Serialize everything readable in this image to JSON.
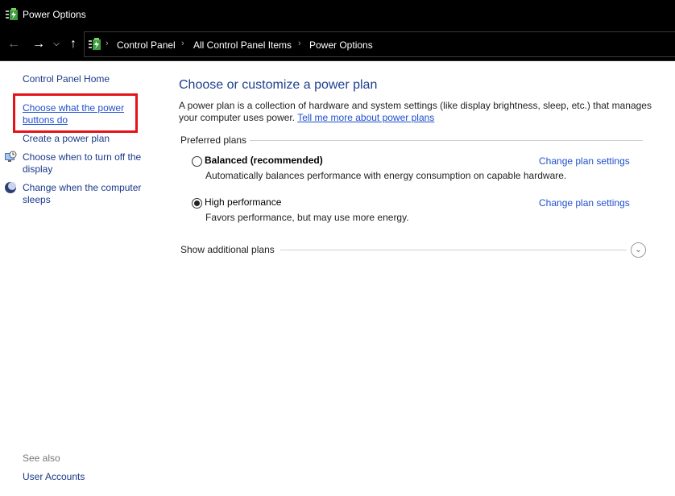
{
  "window": {
    "title": "Power Options",
    "icon": "power-options-icon"
  },
  "nav": {
    "back_icon": "back-arrow-icon",
    "forward_icon": "forward-arrow-icon",
    "recent_icon": "chevron-down-icon",
    "up_icon": "up-arrow-icon",
    "breadcrumb": [
      "Control Panel",
      "All Control Panel Items",
      "Power Options"
    ],
    "separator": "›"
  },
  "sidebar": {
    "home": "Control Panel Home",
    "links": [
      {
        "label": "Choose what the power buttons do"
      },
      {
        "label": "Create a power plan"
      },
      {
        "label": "Choose when to turn off the display",
        "icon": "display-clock-icon"
      },
      {
        "label": "Change when the computer sleeps",
        "icon": "moon-sleep-icon"
      }
    ],
    "see_also": "See also",
    "see_also_links": [
      "User Accounts"
    ]
  },
  "main": {
    "title": "Choose or customize a power plan",
    "description": "A power plan is a collection of hardware and system settings (like display brightness, sleep, etc.) that manages your computer uses power.",
    "description_link": "Tell me more about power plans",
    "preferred_label": "Preferred plans",
    "plans": [
      {
        "name": "Balanced (recommended)",
        "desc": "Automatically balances performance with energy consumption on capable hardware.",
        "link": "Change plan settings",
        "selected": false
      },
      {
        "name": "High performance",
        "desc": "Favors performance, but may use more energy.",
        "link": "Change plan settings",
        "selected": true
      }
    ],
    "show_additional": "Show additional plans"
  },
  "colors": {
    "highlight_box": "#e4131a",
    "link": "#1f4fcf",
    "title": "#1e3f8f"
  }
}
